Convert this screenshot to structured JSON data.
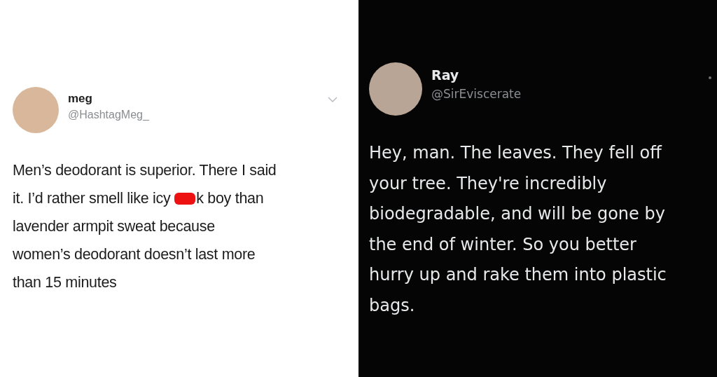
{
  "tweets": [
    {
      "kind": "light",
      "name": "meg",
      "handle": "@HashtagMeg_",
      "menu": {
        "kind": "chevron"
      },
      "lines": [
        [
          {
            "kind": "text",
            "text": "Men’s deodorant is superior. There I said"
          }
        ],
        [
          {
            "kind": "text",
            "text": "it. I’d rather smell like icy "
          },
          {
            "kind": "redaction",
            "color": "#ee1111"
          },
          {
            "kind": "text",
            "text": "k boy than"
          }
        ],
        [
          {
            "kind": "text",
            "text": "lavender armpit sweat because"
          }
        ],
        [
          {
            "kind": "text",
            "text": "women’s deodorant doesn’t last more"
          }
        ],
        [
          {
            "kind": "text",
            "text": "than 15 minutes"
          }
        ]
      ]
    },
    {
      "kind": "dark",
      "name": "Ray",
      "handle": "@SirEviscerate",
      "menu": {
        "kind": "dot"
      },
      "lines": [
        [
          {
            "kind": "text",
            "text": "Hey, man. The leaves. They fell off"
          }
        ],
        [
          {
            "kind": "text",
            "text": "your tree. They're incredibly"
          }
        ],
        [
          {
            "kind": "text",
            "text": "biodegradable, and will be gone by"
          }
        ],
        [
          {
            "kind": "text",
            "text": "the end of winter. So you better"
          }
        ],
        [
          {
            "kind": "text",
            "text": "hurry up and rake them into plastic"
          }
        ],
        [
          {
            "kind": "text",
            "text": "bags."
          }
        ]
      ]
    }
  ]
}
